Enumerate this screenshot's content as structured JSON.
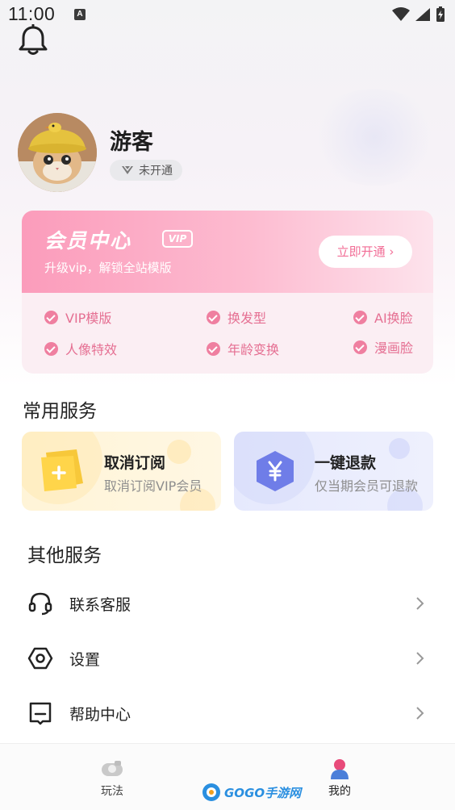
{
  "status_bar": {
    "time": "11:00",
    "notification_letter": "A"
  },
  "profile": {
    "username": "游客",
    "member_status": "未开通"
  },
  "vip": {
    "title": "会员中心",
    "tag": "VIP",
    "subtitle": "升级vip，解锁全站模版",
    "button": "立即开通 ›",
    "features": [
      "VIP模版",
      "换发型",
      "AI换脸",
      "人像特效",
      "年龄变换",
      "漫画脸"
    ]
  },
  "common_services": {
    "title": "常用服务",
    "items": [
      {
        "title": "取消订阅",
        "subtitle": "取消订阅VIP会员",
        "icon": "plus-folder-icon"
      },
      {
        "title": "一键退款",
        "subtitle": "仅当期会员可退款",
        "icon": "yen-hexagon-icon"
      }
    ]
  },
  "other_services": {
    "title": "其他服务",
    "items": [
      {
        "label": "联系客服",
        "icon": "headset-icon"
      },
      {
        "label": "设置",
        "icon": "settings-hexagon-icon"
      },
      {
        "label": "帮助中心",
        "icon": "help-message-icon"
      }
    ]
  },
  "bottom_nav": {
    "items": [
      {
        "label": "玩法",
        "icon": "play-icon"
      },
      {
        "label": "我的",
        "icon": "profile-icon"
      }
    ]
  },
  "watermark": {
    "text": "GOGO手游网"
  },
  "colors": {
    "vip_pink": "#fb9cbb",
    "accent_pink": "#e56f92",
    "service_yellow": "#fff4d7",
    "service_blue": "#e6e9fd"
  }
}
